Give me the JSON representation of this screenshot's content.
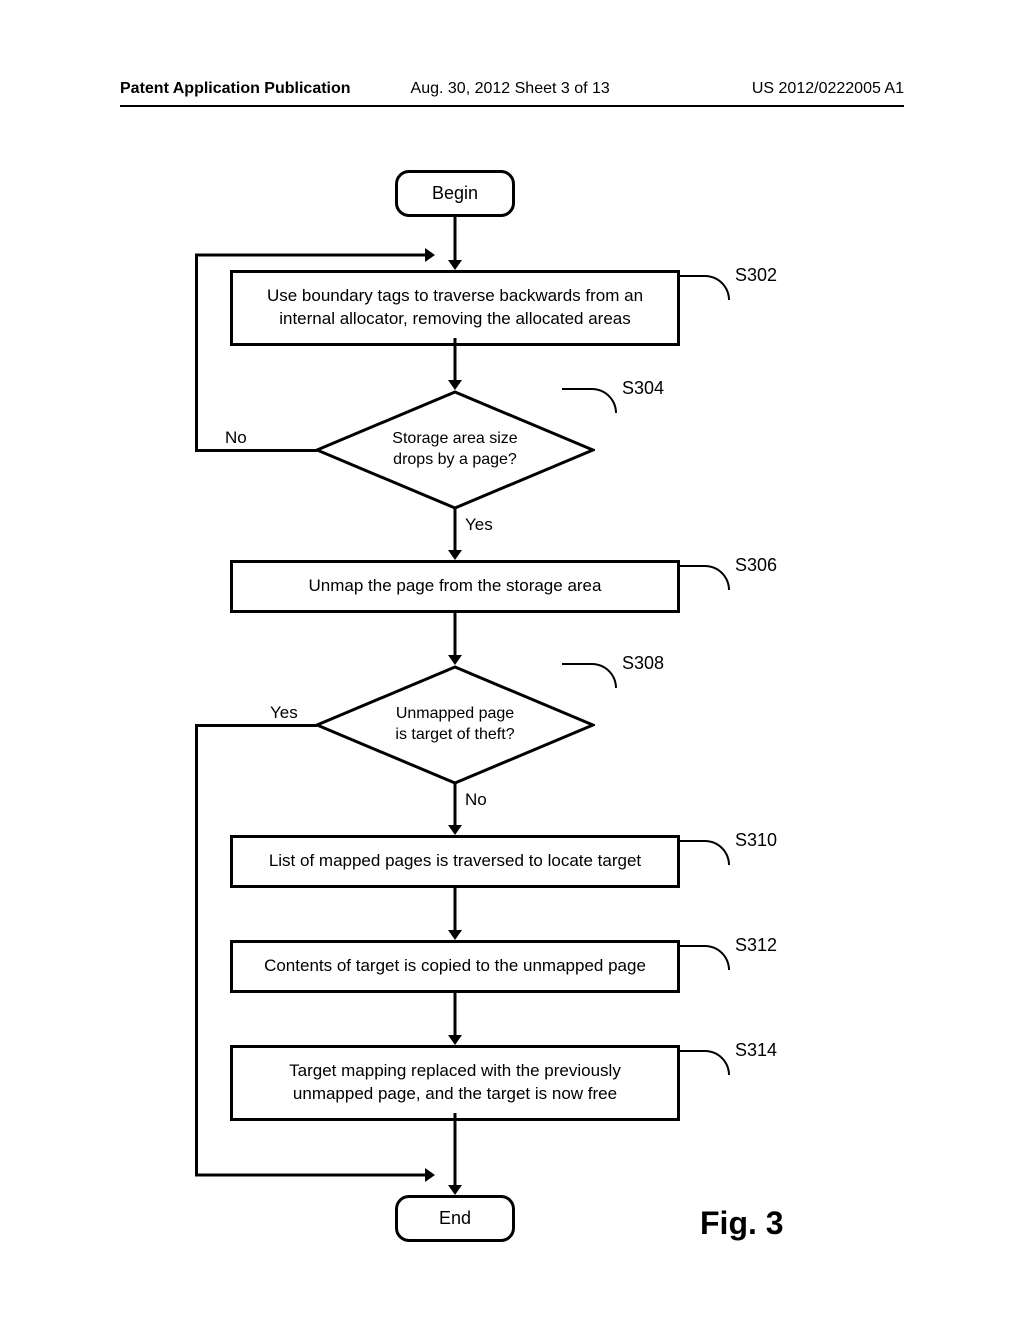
{
  "header": {
    "left": "Patent Application Publication",
    "center": "Aug. 30, 2012  Sheet 3 of 13",
    "right": "US 2012/0222005 A1"
  },
  "flow": {
    "begin": "Begin",
    "s302": "Use boundary tags to traverse backwards from an\ninternal allocator, removing the allocated areas",
    "s304": "Storage area size\ndrops by a page?",
    "s306": "Unmap the page from the storage area",
    "s308": "Unmapped page\nis target of theft?",
    "s310": "List of mapped pages is traversed to locate target",
    "s312": "Contents of target is copied to the unmapped page",
    "s314": "Target mapping replaced with the previously\nunmapped page, and the target is now free",
    "end": "End"
  },
  "labels": {
    "s302": "S302",
    "s304": "S304",
    "s306": "S306",
    "s308": "S308",
    "s310": "S310",
    "s312": "S312",
    "s314": "S314"
  },
  "branches": {
    "no_left": "No",
    "yes_down": "Yes",
    "yes_left": "Yes",
    "no_down": "No"
  },
  "figure_label": "Fig. 3"
}
